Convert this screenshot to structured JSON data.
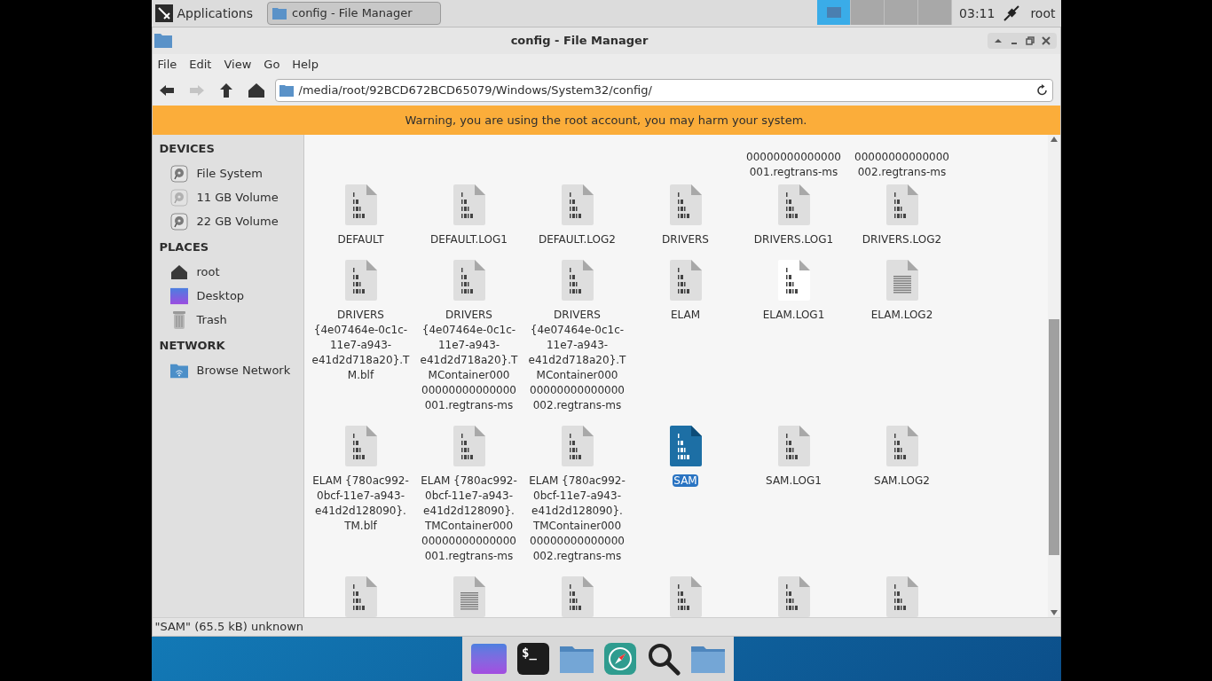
{
  "top_panel": {
    "applications": "Applications",
    "task": "config - File Manager",
    "workspaces": [
      {
        "selected": true
      },
      {
        "selected": false
      },
      {
        "selected": false
      },
      {
        "selected": false
      }
    ],
    "clock": "03:11",
    "user": "root"
  },
  "window": {
    "title": "config - File Manager"
  },
  "menu": [
    "File",
    "Edit",
    "View",
    "Go",
    "Help"
  ],
  "toolbar": {
    "back_disabled": false,
    "forward_disabled": true,
    "path": "/media/root/92BCD672BCD65079/Windows/System32/config/"
  },
  "warning": "Warning, you are using the root account, you may harm your system.",
  "sidebar": [
    {
      "heading": "DEVICES",
      "items": [
        {
          "kind": "disk",
          "label": "File System",
          "mounted": true
        },
        {
          "kind": "disk",
          "label": "11 GB Volume",
          "mounted": false
        },
        {
          "kind": "disk",
          "label": "22 GB Volume",
          "mounted": true
        }
      ]
    },
    {
      "heading": "PLACES",
      "items": [
        {
          "kind": "home",
          "label": "root"
        },
        {
          "kind": "desktop",
          "label": "Desktop"
        },
        {
          "kind": "trash",
          "label": "Trash"
        }
      ]
    },
    {
      "heading": "NETWORK",
      "items": [
        {
          "kind": "network",
          "label": "Browse Network"
        }
      ]
    }
  ],
  "partial_row": [
    {
      "name": "00000000000000 001.regtrans-ms"
    },
    {
      "name": "00000000000000 002.regtrans-ms"
    }
  ],
  "files": [
    [
      {
        "name": "DEFAULT",
        "kind": "binary",
        "selected": false,
        "hovered": false
      },
      {
        "name": "DEFAULT.LOG1",
        "kind": "binary",
        "selected": false,
        "hovered": false
      },
      {
        "name": "DEFAULT.LOG2",
        "kind": "binary",
        "selected": false,
        "hovered": false
      },
      {
        "name": "DRIVERS",
        "kind": "binary",
        "selected": false,
        "hovered": false
      },
      {
        "name": "DRIVERS.LOG1",
        "kind": "binary",
        "selected": false,
        "hovered": false
      },
      {
        "name": "DRIVERS.LOG2",
        "kind": "binary",
        "selected": false,
        "hovered": false
      }
    ],
    [
      {
        "name": "DRIVERS {4e07464e-0c1c-11e7-a943-e41d2d718a20}.TM.blf",
        "kind": "binary",
        "selected": false,
        "hovered": false
      },
      {
        "name": "DRIVERS {4e07464e-0c1c-11e7-a943-e41d2d718a20}.TMContainer000 00000000000000 001.regtrans-ms",
        "kind": "binary",
        "selected": false,
        "hovered": false
      },
      {
        "name": "DRIVERS {4e07464e-0c1c-11e7-a943-e41d2d718a20}.TMContainer000 00000000000000 002.regtrans-ms",
        "kind": "binary",
        "selected": false,
        "hovered": false
      },
      {
        "name": "ELAM",
        "kind": "binary",
        "selected": false,
        "hovered": false
      },
      {
        "name": "ELAM.LOG1",
        "kind": "binary",
        "selected": false,
        "hovered": true
      },
      {
        "name": "ELAM.LOG2",
        "kind": "text",
        "selected": false,
        "hovered": false
      }
    ],
    [
      {
        "name": "ELAM {780ac992-0bcf-11e7-a943-e41d2d128090}.TM.blf",
        "kind": "binary",
        "selected": false,
        "hovered": false
      },
      {
        "name": "ELAM {780ac992-0bcf-11e7-a943-e41d2d128090}.TMContainer000 00000000000000 001.regtrans-ms",
        "kind": "binary",
        "selected": false,
        "hovered": false
      },
      {
        "name": "ELAM {780ac992-0bcf-11e7-a943-e41d2d128090}.TMContainer000 00000000000000 002.regtrans-ms",
        "kind": "binary",
        "selected": false,
        "hovered": false
      },
      {
        "name": "SAM",
        "kind": "binary",
        "selected": true,
        "hovered": false
      },
      {
        "name": "SAM.LOG1",
        "kind": "binary",
        "selected": false,
        "hovered": false
      },
      {
        "name": "SAM.LOG2",
        "kind": "binary",
        "selected": false,
        "hovered": false
      }
    ]
  ],
  "bottom_row": [
    {
      "kind": "binary"
    },
    {
      "kind": "text"
    },
    {
      "kind": "binary"
    },
    {
      "kind": "binary"
    },
    {
      "kind": "binary"
    },
    {
      "kind": "binary"
    }
  ],
  "status_bar": "\"SAM\" (65.5 kB) unknown",
  "dock": [
    {
      "kind": "desktop"
    },
    {
      "kind": "terminal",
      "glyph": "$_"
    },
    {
      "kind": "folder"
    },
    {
      "kind": "browser"
    },
    {
      "kind": "search"
    },
    {
      "kind": "folder"
    }
  ]
}
